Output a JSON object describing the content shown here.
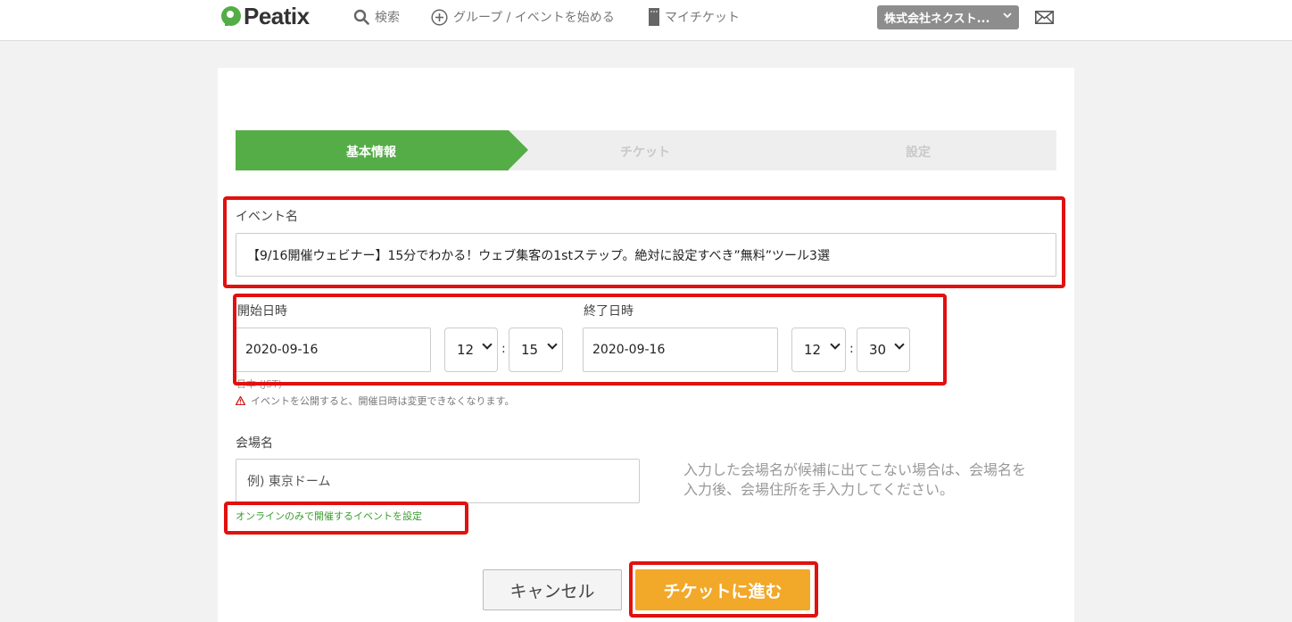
{
  "header": {
    "logo": "Peatix",
    "search_label": "検索",
    "start_label": "グループ / イベントを始める",
    "ticket_label": "マイチケット",
    "org_name": "株式会社ネクスト..."
  },
  "steps": [
    "基本情報",
    "チケット",
    "設定"
  ],
  "event_name": {
    "label": "イベント名",
    "value": "【9/16開催ウェビナー】15分でわかる！ウェブ集客の1stステップ。絶対に設定すべき”無料”ツール3選"
  },
  "start": {
    "label": "開始日時",
    "date": "2020-09-16",
    "hour": "12",
    "minute": "15"
  },
  "end": {
    "label": "終了日時",
    "date": "2020-09-16",
    "hour": "12",
    "minute": "30"
  },
  "separator": ":",
  "timezone_text": "日本 (JST)",
  "warning_text": "イベントを公開すると、開催日時は変更できなくなります。",
  "venue": {
    "label": "会場名",
    "placeholder": "例) 東京ドーム",
    "hint": "入力した会場名が候補に出てこない場合は、会場名を入力後、会場住所を手入力してください。",
    "online_link": "オンラインのみで開催するイベントを設定"
  },
  "buttons": {
    "cancel": "キャンセル",
    "next": "チケットに進む"
  },
  "colors": {
    "brand_green": "#55ad47",
    "next_orange": "#f2a829",
    "annotation_red": "#e0110f"
  }
}
